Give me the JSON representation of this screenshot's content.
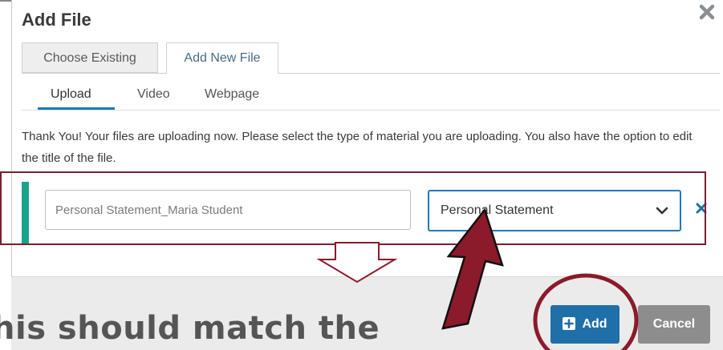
{
  "dialog": {
    "title": "Add File",
    "close_icon": "close-x-icon"
  },
  "tabs": [
    {
      "label": "Choose Existing",
      "active": false
    },
    {
      "label": "Add New File",
      "active": true
    }
  ],
  "subtabs": [
    {
      "label": "Upload",
      "active": true
    },
    {
      "label": "Video",
      "active": false
    },
    {
      "label": "Webpage",
      "active": false
    }
  ],
  "instructions": "Thank You! Your files are uploading now. Please select the type of material you are uploading. You also have the option to edit the title of the file.",
  "file_row": {
    "title_value": "Personal Statement_Maria Student",
    "type_value": "Personal Statement",
    "remove_icon": "remove-x-icon"
  },
  "footer": {
    "add_label": "Add",
    "cancel_label": "Cancel"
  },
  "annotation": {
    "caption": "his should match the",
    "outline_color": "#7a1f2f",
    "arrow_color": "#8b1a2b"
  },
  "colors": {
    "accent": "#1f7ab8",
    "upload_bar": "#1aa28a",
    "add_button": "#1f6fa8",
    "cancel_button": "#8d8d8d"
  }
}
